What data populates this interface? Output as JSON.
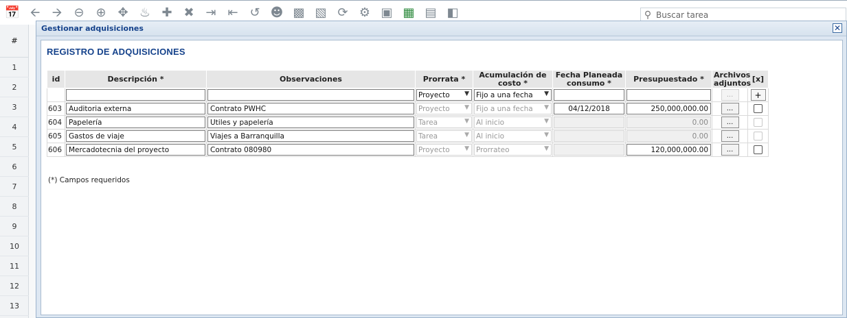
{
  "toolbar": {
    "icons": [
      "calendar-icon",
      "arrow-left-icon",
      "arrow-right-icon",
      "zoom-out-icon",
      "zoom-in-icon",
      "move-icon",
      "fire-icon",
      "add-icon",
      "delete-icon",
      "indent-icon",
      "outdent-icon",
      "link-icon",
      "user-icon",
      "puzzle-icon",
      "cart-icon",
      "refresh-icon",
      "gear-icon",
      "save-icon",
      "excel-icon",
      "document-search-icon",
      "exit-icon"
    ],
    "search_placeholder": "Buscar tarea"
  },
  "grid": {
    "header": "#",
    "rows": [
      "1",
      "2",
      "3",
      "4",
      "5",
      "6",
      "7",
      "8",
      "9",
      "10",
      "11",
      "12",
      "13"
    ]
  },
  "dialog": {
    "title": "Gestionar adquisiciones",
    "close": "✕",
    "heading": "REGISTRO DE ADQUISICIONES",
    "columns": {
      "id": "id",
      "descripcion": "Descripción *",
      "observaciones": "Observaciones",
      "prorrata": "Prorrata *",
      "acumulacion": "Acumulación de costo *",
      "fecha": "Fecha Planeada consumo *",
      "presupuestado": "Presupuestado *",
      "archivos": "Archivos adjuntos",
      "x": "[x]"
    },
    "new_row": {
      "prorrata": "Proyecto",
      "acumulacion": "Fijo a una fecha",
      "archivos": "...",
      "add": "+"
    },
    "rows": [
      {
        "id": "603",
        "descripcion": "Auditoria externa",
        "observaciones": "Contrato PWHC",
        "prorrata": "Proyecto",
        "acumulacion": "Fijo a una fecha",
        "fecha": "04/12/2018",
        "presupuestado": "250,000,000.00",
        "archivos": "..."
      },
      {
        "id": "604",
        "descripcion": "Papelería",
        "observaciones": "Utiles y papelería",
        "prorrata": "Tarea",
        "acumulacion": "Al inicio",
        "fecha": "",
        "presupuestado": "0.00",
        "archivos": "..."
      },
      {
        "id": "605",
        "descripcion": "Gastos de viaje",
        "observaciones": "Viajes a Barranquilla",
        "prorrata": "Tarea",
        "acumulacion": "Al inicio",
        "fecha": "",
        "presupuestado": "0.00",
        "archivos": "..."
      },
      {
        "id": "606",
        "descripcion": "Mercadotecnia del proyecto",
        "observaciones": "Contrato 080980",
        "prorrata": "Proyecto",
        "acumulacion": "Prorrateo",
        "fecha": "",
        "presupuestado": "120,000,000.00",
        "archivos": "..."
      }
    ],
    "required_note": "(*) Campos requeridos"
  }
}
